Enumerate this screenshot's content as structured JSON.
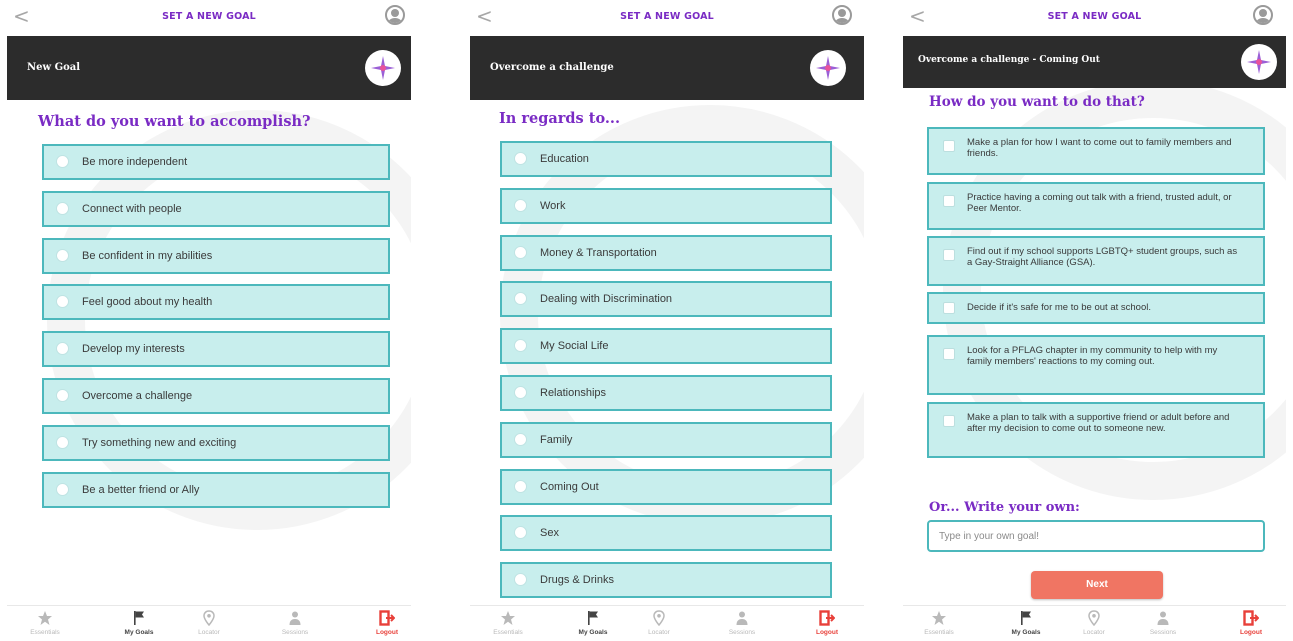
{
  "colors": {
    "accent_purple": "#7a2bc4",
    "option_fill": "#c8eeed",
    "option_border": "#4cb8bc",
    "header_dark": "#2c2c2c",
    "next_button": "#f07563",
    "logout_red": "#e8403a"
  },
  "screens": [
    {
      "topbar_title": "SET A NEW GOAL",
      "header_title": "New Goal",
      "heading": "What do you want to accomplish?",
      "options": [
        "Be more independent",
        "Connect with people",
        "Be confident in my abilities",
        "Feel good about my health",
        "Develop my interests",
        "Overcome a challenge",
        "Try something new and exciting",
        "Be a better friend or Ally"
      ]
    },
    {
      "topbar_title": "SET A NEW GOAL",
      "header_title": "Overcome a challenge",
      "heading": "In regards to...",
      "options": [
        "Education",
        "Work",
        "Money & Transportation",
        "Dealing with Discrimination",
        "My Social Life",
        "Relationships",
        "Family",
        "Coming Out",
        "Sex",
        "Drugs & Drinks"
      ]
    },
    {
      "topbar_title": "SET A NEW GOAL",
      "header_title": "Overcome a challenge - Coming Out",
      "heading": "How do you want to do that?",
      "checkboxes": [
        "Make a plan for how I want to come out to family members and friends.",
        "Practice having a coming out talk with a friend, trusted adult, or Peer Mentor.",
        "Find out if my school supports LGBTQ+ student groups, such as a Gay-Straight Alliance (GSA).",
        "Decide if it's safe for me to be out at school.",
        "Look for a PFLAG chapter in my community to help with my family members' reactions to my coming out.",
        "Make a plan to talk with a supportive friend or adult before and after my decision to come out to someone new."
      ],
      "write_own_heading": "Or... Write your own:",
      "input_placeholder": "Type in your own goal!",
      "next_label": "Next"
    }
  ],
  "bottom_nav": [
    {
      "label": "Essentials",
      "icon": "star-icon",
      "glyph": "★",
      "state": "inactive"
    },
    {
      "label": "My Goals",
      "icon": "flag-icon",
      "glyph": "⚑",
      "state": "active"
    },
    {
      "label": "Locator",
      "icon": "location-pin-icon",
      "glyph": "",
      "state": "inactive"
    },
    {
      "label": "Sessions",
      "icon": "person-icon",
      "glyph": "",
      "state": "inactive"
    },
    {
      "label": "Logout",
      "icon": "logout-icon",
      "glyph": "",
      "state": "logout"
    }
  ]
}
